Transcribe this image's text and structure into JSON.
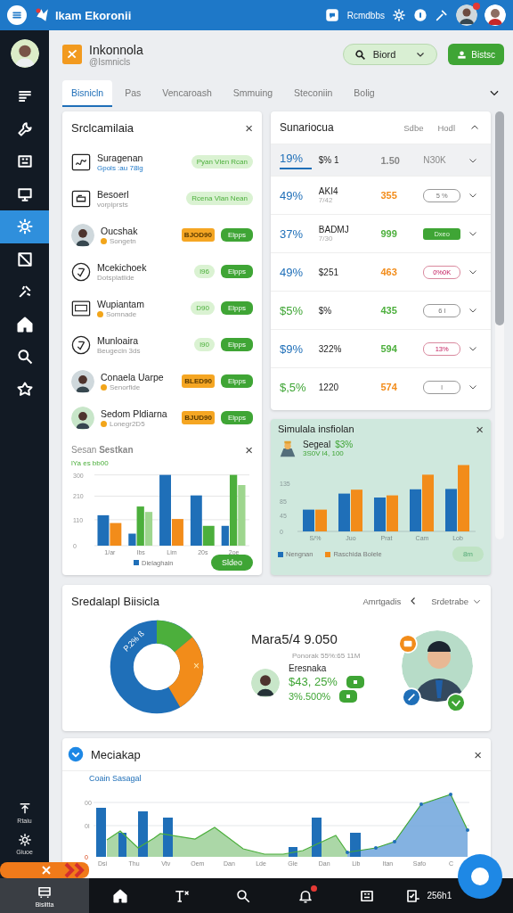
{
  "top_bar": {
    "title": "Ikam Ekoronii",
    "action_label": "Rcmdbbs",
    "notification": true
  },
  "sidebar": {
    "items": [
      {
        "kind": "list",
        "selected": false
      },
      {
        "kind": "wrench",
        "selected": false
      },
      {
        "kind": "board",
        "selected": false
      },
      {
        "kind": "presentation",
        "selected": false
      },
      {
        "kind": "gear",
        "selected": true
      },
      {
        "kind": "image",
        "selected": false
      },
      {
        "kind": "tools",
        "selected": false
      },
      {
        "kind": "home",
        "selected": false
      },
      {
        "kind": "search",
        "selected": false
      },
      {
        "kind": "star",
        "selected": false
      }
    ],
    "bottom_items": [
      {
        "kind": "upload",
        "label": "Rtaiu"
      },
      {
        "kind": "gear",
        "label": "Giuoe"
      }
    ]
  },
  "header": {
    "title": "Inkonnola",
    "subtitle": "@Ismnicls",
    "search_label": "Biord",
    "primary_label": "Bistsc"
  },
  "tabs": [
    {
      "label": "Bisnicln",
      "selected": true
    },
    {
      "label": "Pas",
      "selected": false
    },
    {
      "label": "Vencaroash",
      "selected": false
    },
    {
      "label": "Smmuing",
      "selected": false
    },
    {
      "label": "Steconiin",
      "selected": false
    },
    {
      "label": "Bolig",
      "selected": false
    }
  ],
  "list_card": {
    "title": "Srclcamilaia",
    "close": "×",
    "rows": [
      {
        "kind": "square",
        "name": "Suragenan",
        "sub": "Gpols :au 78lg",
        "link": true,
        "dot": false,
        "tag": "Pyan Vlen Rcan"
      },
      {
        "kind": "device",
        "name": "Besoerl",
        "sub": "vorpiprsts",
        "link": false,
        "dot": false,
        "tag": "Rcena Vlan Nean"
      },
      {
        "kind": "avatar",
        "name": "Oucshak",
        "sub": "Songetn",
        "link": false,
        "dot": true,
        "badge": "BJOD90",
        "action": "Elpps"
      },
      {
        "kind": "circle",
        "name": "Mcekichoek",
        "sub": "Dotsplatlide",
        "link": false,
        "dot": false,
        "tag": "l96",
        "action": "Elpps"
      },
      {
        "kind": "screen",
        "name": "Wupiantam",
        "sub": "Somnade",
        "link": false,
        "dot": true,
        "tag": "D90",
        "action": "Elpps"
      },
      {
        "kind": "circle",
        "name": "Munloaira",
        "sub": "Beugecin 3ds",
        "link": false,
        "dot": false,
        "tag": "l90",
        "action": "Elpps"
      },
      {
        "kind": "avatar",
        "name": "Conaela Uarpe",
        "sub": "Senorfide",
        "link": false,
        "dot": true,
        "badge": "BLED90",
        "action": "Elpps"
      },
      {
        "kind": "avatar",
        "name": "Sedom Pldiarna",
        "sub": "Lonegr2D5",
        "link": false,
        "dot": true,
        "badge": "BJUD90",
        "action": "Elpps"
      }
    ],
    "chart_title": "Sesan **Sestkan**",
    "chart_close": "×",
    "chart_subtitle": "lYa es bb00",
    "chart_button": "Sldeo",
    "chart_data": {
      "type": "bar",
      "categories": [
        "1/ar",
        "Ibs",
        "Lim",
        "20s",
        "2oe"
      ],
      "ylim": [
        0,
        310
      ],
      "yticks": [
        0,
        110,
        210,
        300
      ],
      "grid": true,
      "series": [
        {
          "name": "Dielaghain",
          "color": "#1f6fb8",
          "values": [
            129,
            51,
            300,
            213,
            84
          ]
        },
        {
          "color": "#f28c1a",
          "values": [
            96,
            null,
            113,
            null,
            null
          ]
        },
        {
          "color": "#4caf3c",
          "values": [
            null,
            166,
            null,
            84,
            300
          ]
        },
        {
          "color": "#9ed68e",
          "values": [
            null,
            143,
            null,
            null,
            257
          ]
        }
      ]
    }
  },
  "table_card": {
    "title": "Sunariocua",
    "columns": [
      "Sdbe",
      "Hodl"
    ],
    "rows": [
      {
        "kind": "plain",
        "percent": "19%",
        "gain": false,
        "name": "$% 1",
        "value": "1.50",
        "color": "#888888",
        "tag": "NЗ0K",
        "selected": true
      },
      {
        "kind": "outline",
        "percent": "49%",
        "gain": false,
        "name": "AKI4",
        "sub": "7/42",
        "value": "355",
        "color": "#f28c1a",
        "tag": "5 %",
        "selected": false
      },
      {
        "kind": "filled",
        "percent": "37%",
        "gain": false,
        "name": "BADMJ",
        "sub": "7/30",
        "value": "999",
        "color": "#4caf3c",
        "tag": "Dxeo",
        "selected": false
      },
      {
        "kind": "alert",
        "percent": "49%",
        "gain": false,
        "name": "$251",
        "value": "463",
        "color": "#f28c1a",
        "tag": "0%0K",
        "selected": false
      },
      {
        "kind": "outline",
        "percent": "$5%",
        "gain": true,
        "name": "$%",
        "value": "435",
        "color": "#4caf3c",
        "tag": "6 l",
        "selected": false
      },
      {
        "kind": "alert",
        "percent": "$9%",
        "gain": false,
        "name": "322%",
        "value": "594",
        "color": "#4caf3c",
        "tag": "13%",
        "selected": false
      },
      {
        "kind": "outline",
        "percent": "$,5%",
        "gain": true,
        "name": "1220",
        "value": "574",
        "color": "#f28c1a",
        "tag": "l",
        "selected": false
      }
    ]
  },
  "simulation_card": {
    "title": "Simulala insfiolan",
    "close": "×",
    "name": "Segeal",
    "change": "$3%",
    "sub": "3S0V l4, 100",
    "pill": "8m",
    "chart_data": {
      "type": "bar",
      "categories": [
        "S/%",
        "Juo",
        "Prat",
        "Cam",
        "Lob"
      ],
      "ylim": [
        0,
        190
      ],
      "yticks": [
        0,
        45,
        85,
        135
      ],
      "series": [
        {
          "name": "Nengnan",
          "color": "#1f6fb8",
          "values": [
            61,
            106,
            95,
            118,
            119
          ]
        },
        {
          "name": "Raschida Bolele",
          "color": "#f28c1a",
          "values": [
            61,
            117,
            101,
            159,
            186
          ]
        }
      ]
    }
  },
  "summary_card": {
    "title": "Sredalapl Biisicla",
    "filter_label": "Amrtgadis",
    "sort_label": "Srdetrabe",
    "donut_labels": [
      "P.2% ß",
      "×"
    ],
    "headline": "Mara5/4 9.050",
    "caption": "Ponorak 55%:65 11M",
    "person": "Eresnaka",
    "stats": [
      "$43, 25%",
      "3%.500%"
    ]
  },
  "media_card": {
    "title": "Meciakap",
    "close": "×",
    "chart_title": "Coain Sasagal",
    "y_labels": [
      "00",
      "0l",
      "0"
    ],
    "x_labels": [
      "Dsi",
      "Thu",
      "Vtv",
      "Oem",
      "Dan",
      "Lde",
      "Gle",
      "Dan",
      "Lib",
      "Itan",
      "Safo",
      "C"
    ]
  },
  "bottom_nav": [
    {
      "kind": "bus",
      "label": "Bisiitta",
      "selected": true,
      "badge": false
    },
    {
      "kind": "home",
      "selected": false,
      "badge": false
    },
    {
      "kind": "text",
      "selected": false,
      "badge": false
    },
    {
      "kind": "search",
      "selected": false,
      "badge": false
    },
    {
      "kind": "bell",
      "selected": false,
      "badge": true
    },
    {
      "kind": "board",
      "selected": false,
      "badge": false
    },
    {
      "kind": "checklist",
      "label": "256h1",
      "selected": false,
      "badge": false
    }
  ]
}
